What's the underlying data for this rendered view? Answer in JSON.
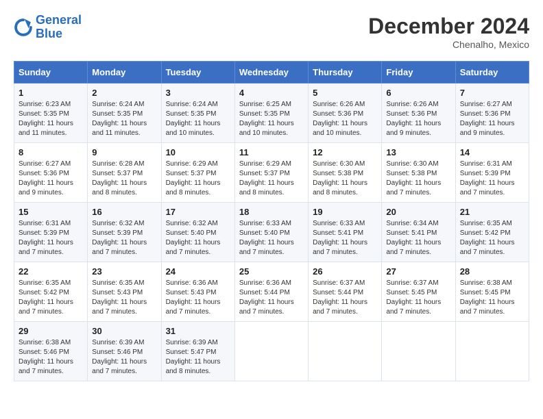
{
  "logo": {
    "line1": "General",
    "line2": "Blue"
  },
  "title": "December 2024",
  "subtitle": "Chenalho, Mexico",
  "days_of_week": [
    "Sunday",
    "Monday",
    "Tuesday",
    "Wednesday",
    "Thursday",
    "Friday",
    "Saturday"
  ],
  "weeks": [
    [
      {
        "day": "1",
        "sunrise": "6:23 AM",
        "sunset": "5:35 PM",
        "daylight": "11 hours and 11 minutes."
      },
      {
        "day": "2",
        "sunrise": "6:24 AM",
        "sunset": "5:35 PM",
        "daylight": "11 hours and 11 minutes."
      },
      {
        "day": "3",
        "sunrise": "6:24 AM",
        "sunset": "5:35 PM",
        "daylight": "11 hours and 10 minutes."
      },
      {
        "day": "4",
        "sunrise": "6:25 AM",
        "sunset": "5:35 PM",
        "daylight": "11 hours and 10 minutes."
      },
      {
        "day": "5",
        "sunrise": "6:26 AM",
        "sunset": "5:36 PM",
        "daylight": "11 hours and 10 minutes."
      },
      {
        "day": "6",
        "sunrise": "6:26 AM",
        "sunset": "5:36 PM",
        "daylight": "11 hours and 9 minutes."
      },
      {
        "day": "7",
        "sunrise": "6:27 AM",
        "sunset": "5:36 PM",
        "daylight": "11 hours and 9 minutes."
      }
    ],
    [
      {
        "day": "8",
        "sunrise": "6:27 AM",
        "sunset": "5:36 PM",
        "daylight": "11 hours and 9 minutes."
      },
      {
        "day": "9",
        "sunrise": "6:28 AM",
        "sunset": "5:37 PM",
        "daylight": "11 hours and 8 minutes."
      },
      {
        "day": "10",
        "sunrise": "6:29 AM",
        "sunset": "5:37 PM",
        "daylight": "11 hours and 8 minutes."
      },
      {
        "day": "11",
        "sunrise": "6:29 AM",
        "sunset": "5:37 PM",
        "daylight": "11 hours and 8 minutes."
      },
      {
        "day": "12",
        "sunrise": "6:30 AM",
        "sunset": "5:38 PM",
        "daylight": "11 hours and 8 minutes."
      },
      {
        "day": "13",
        "sunrise": "6:30 AM",
        "sunset": "5:38 PM",
        "daylight": "11 hours and 7 minutes."
      },
      {
        "day": "14",
        "sunrise": "6:31 AM",
        "sunset": "5:39 PM",
        "daylight": "11 hours and 7 minutes."
      }
    ],
    [
      {
        "day": "15",
        "sunrise": "6:31 AM",
        "sunset": "5:39 PM",
        "daylight": "11 hours and 7 minutes."
      },
      {
        "day": "16",
        "sunrise": "6:32 AM",
        "sunset": "5:39 PM",
        "daylight": "11 hours and 7 minutes."
      },
      {
        "day": "17",
        "sunrise": "6:32 AM",
        "sunset": "5:40 PM",
        "daylight": "11 hours and 7 minutes."
      },
      {
        "day": "18",
        "sunrise": "6:33 AM",
        "sunset": "5:40 PM",
        "daylight": "11 hours and 7 minutes."
      },
      {
        "day": "19",
        "sunrise": "6:33 AM",
        "sunset": "5:41 PM",
        "daylight": "11 hours and 7 minutes."
      },
      {
        "day": "20",
        "sunrise": "6:34 AM",
        "sunset": "5:41 PM",
        "daylight": "11 hours and 7 minutes."
      },
      {
        "day": "21",
        "sunrise": "6:35 AM",
        "sunset": "5:42 PM",
        "daylight": "11 hours and 7 minutes."
      }
    ],
    [
      {
        "day": "22",
        "sunrise": "6:35 AM",
        "sunset": "5:42 PM",
        "daylight": "11 hours and 7 minutes."
      },
      {
        "day": "23",
        "sunrise": "6:35 AM",
        "sunset": "5:43 PM",
        "daylight": "11 hours and 7 minutes."
      },
      {
        "day": "24",
        "sunrise": "6:36 AM",
        "sunset": "5:43 PM",
        "daylight": "11 hours and 7 minutes."
      },
      {
        "day": "25",
        "sunrise": "6:36 AM",
        "sunset": "5:44 PM",
        "daylight": "11 hours and 7 minutes."
      },
      {
        "day": "26",
        "sunrise": "6:37 AM",
        "sunset": "5:44 PM",
        "daylight": "11 hours and 7 minutes."
      },
      {
        "day": "27",
        "sunrise": "6:37 AM",
        "sunset": "5:45 PM",
        "daylight": "11 hours and 7 minutes."
      },
      {
        "day": "28",
        "sunrise": "6:38 AM",
        "sunset": "5:45 PM",
        "daylight": "11 hours and 7 minutes."
      }
    ],
    [
      {
        "day": "29",
        "sunrise": "6:38 AM",
        "sunset": "5:46 PM",
        "daylight": "11 hours and 7 minutes."
      },
      {
        "day": "30",
        "sunrise": "6:39 AM",
        "sunset": "5:46 PM",
        "daylight": "11 hours and 7 minutes."
      },
      {
        "day": "31",
        "sunrise": "6:39 AM",
        "sunset": "5:47 PM",
        "daylight": "11 hours and 8 minutes."
      },
      null,
      null,
      null,
      null
    ]
  ]
}
